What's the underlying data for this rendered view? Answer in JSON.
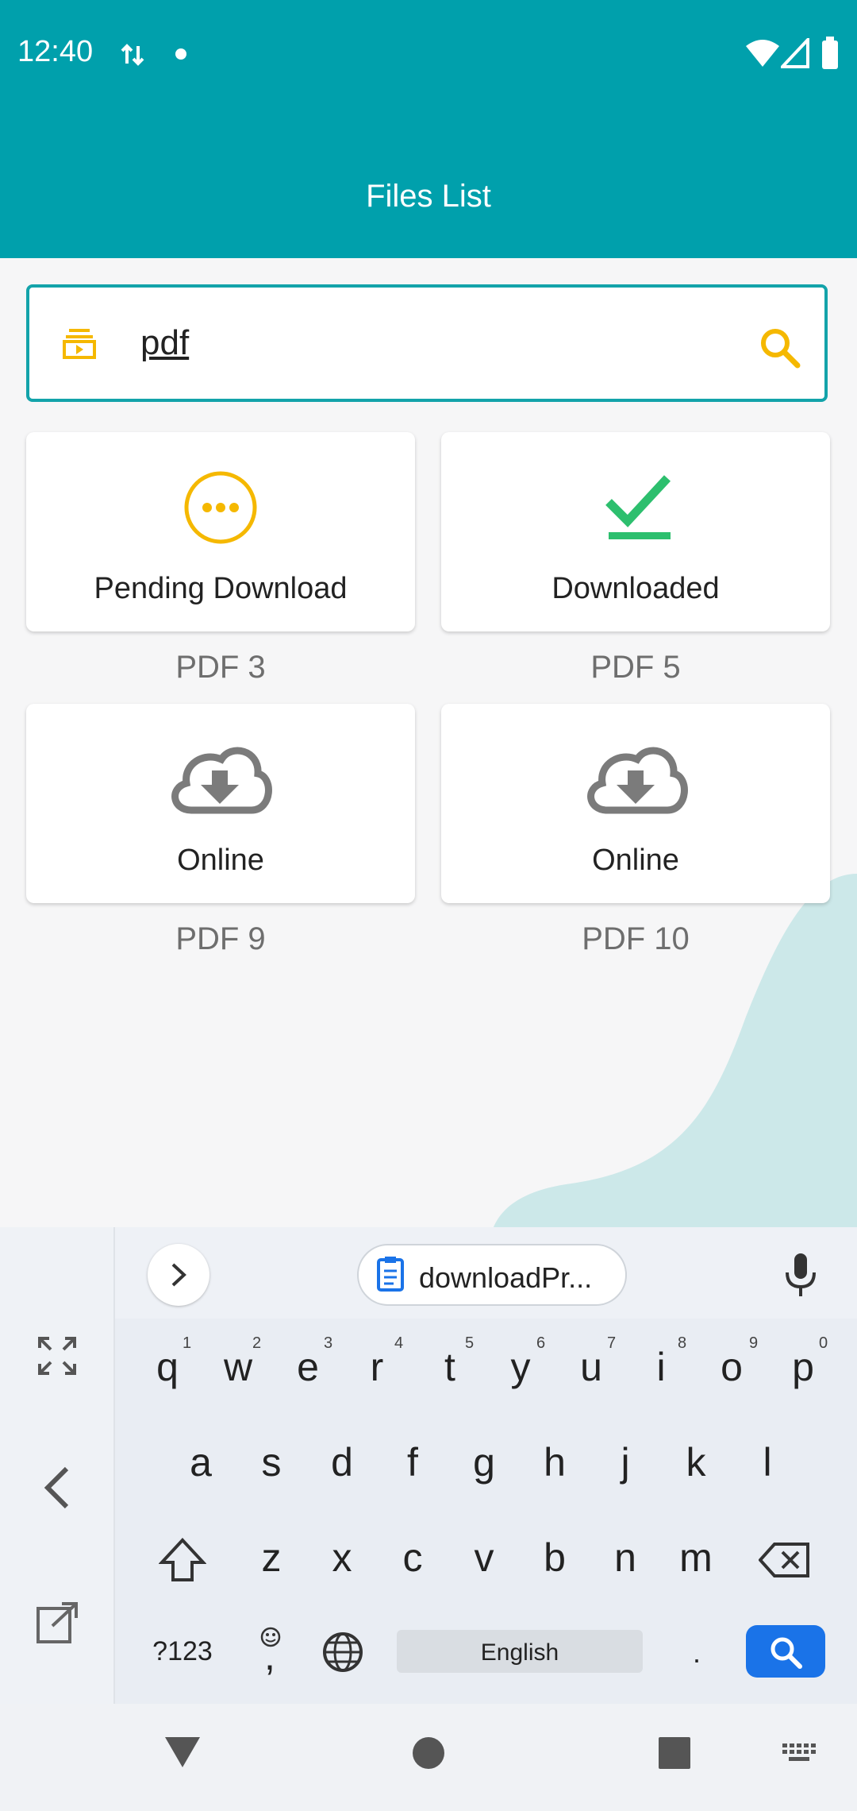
{
  "status": {
    "time": "12:40"
  },
  "app": {
    "title": "Files List"
  },
  "search": {
    "value": "pdf"
  },
  "cards": [
    {
      "status": "Pending Download",
      "name": "PDF 3",
      "icon": "pending-icon"
    },
    {
      "status": "Downloaded",
      "name": "PDF 5",
      "icon": "check-icon"
    },
    {
      "status": "Online",
      "name": "PDF 9",
      "icon": "cloud-download-icon"
    },
    {
      "status": "Online",
      "name": "PDF 10",
      "icon": "cloud-download-icon"
    }
  ],
  "keyboard": {
    "clipboard_chip": "downloadPr...",
    "row1": [
      "q",
      "w",
      "e",
      "r",
      "t",
      "y",
      "u",
      "i",
      "o",
      "p"
    ],
    "row1_nums": [
      "1",
      "2",
      "3",
      "4",
      "5",
      "6",
      "7",
      "8",
      "9",
      "0"
    ],
    "row2": [
      "a",
      "s",
      "d",
      "f",
      "g",
      "h",
      "j",
      "k",
      "l"
    ],
    "row3": [
      "z",
      "x",
      "c",
      "v",
      "b",
      "n",
      "m"
    ],
    "symbols_key": "?123",
    "comma_key": ",",
    "space_label": "English",
    "period_key": "."
  },
  "colors": {
    "header": "#00a0ac",
    "accent_yellow": "#f5b800",
    "accent_green": "#2dbf6e",
    "enter_blue": "#1a73e8"
  }
}
